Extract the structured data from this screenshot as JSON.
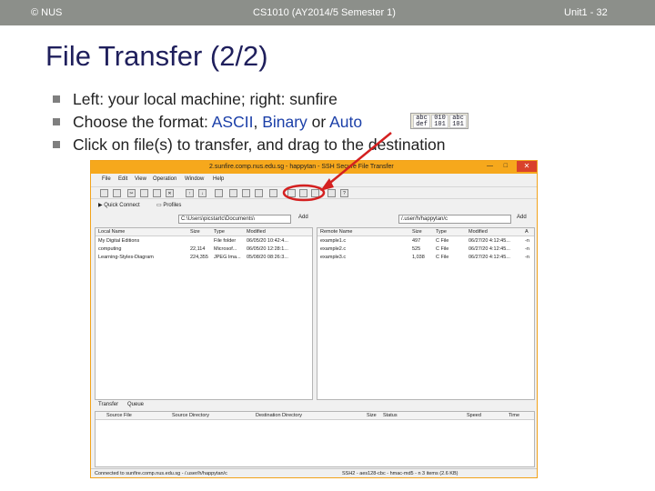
{
  "slide_header": {
    "left": "© NUS",
    "center": "CS1010 (AY2014/5 Semester 1)",
    "right": "Unit1 - 32"
  },
  "title": "File Transfer (2/2)",
  "bullets": [
    {
      "text": "Left: your local machine; right: sunfire"
    },
    {
      "pre": "Choose the format: ",
      "ascii": "ASCII",
      "sep": ", ",
      "binary": "Binary",
      "or": " or ",
      "auto": "Auto"
    },
    {
      "text": "Click on file(s) to transfer, and drag to the destination"
    }
  ],
  "format_icons": [
    "abc def",
    "010 101",
    "abc 101"
  ],
  "app": {
    "title": "2.sunfire.comp.nus.edu.sg - happytan - SSH Secure File Transfer",
    "menu": [
      "File",
      "Edit",
      "View",
      "Operation",
      "Window",
      "Help"
    ],
    "quick_connect": "Quick Connect",
    "profiles": "Profiles",
    "local_path": "C:\\Users\\picstartc\\Documents\\",
    "remote_path": "/.user/h/happytan/c",
    "add_label": "Add",
    "local_columns": [
      "Local Name",
      "Size",
      "Type",
      "Modified"
    ],
    "local_files": [
      {
        "name": "My Digital Editions",
        "size": "",
        "type": "File folder",
        "modified": "06/05/20 10:42:4..."
      },
      {
        "name": "computing",
        "size": "22,114",
        "type": "Microsof...",
        "modified": "06/05/20 12:28:1..."
      },
      {
        "name": "Learning-Styles-Diagram",
        "size": "224,355",
        "type": "JPEG Ima...",
        "modified": "05/08/20 08:26:3..."
      }
    ],
    "remote_columns": [
      "Remote Name",
      "Size",
      "Type",
      "Modified",
      "A"
    ],
    "remote_files": [
      {
        "name": "example1.c",
        "size": "497",
        "type": "C File",
        "modified": "06/27/20 4:12:45...",
        "attr": "-n"
      },
      {
        "name": "example2.c",
        "size": "525",
        "type": "C File",
        "modified": "06/27/20 4:12:45...",
        "attr": "-n"
      },
      {
        "name": "example3.c",
        "size": "1,038",
        "type": "C File",
        "modified": "06/27/20 4:12:45...",
        "attr": "-n"
      }
    ],
    "queue_tabs": [
      "Transfer",
      "Queue"
    ],
    "queue_columns": [
      "Source File",
      "Source Directory",
      "Destination Directory",
      "Size",
      "Status",
      "Speed",
      "Time"
    ],
    "status_left": "Connected to sunfire.comp.nus.edu.sg - /.user/h/happytan/c",
    "status_right": "SSH2 - aes128-cbc - hmac-md5 - n  3 items (2.6 KB)"
  },
  "colors": {
    "header_bg": "#8c8f8a",
    "title": "#1f1f5c",
    "highlight": "#1b3fa8",
    "window_border": "#f6a81c",
    "annotation_red": "#d42020"
  }
}
